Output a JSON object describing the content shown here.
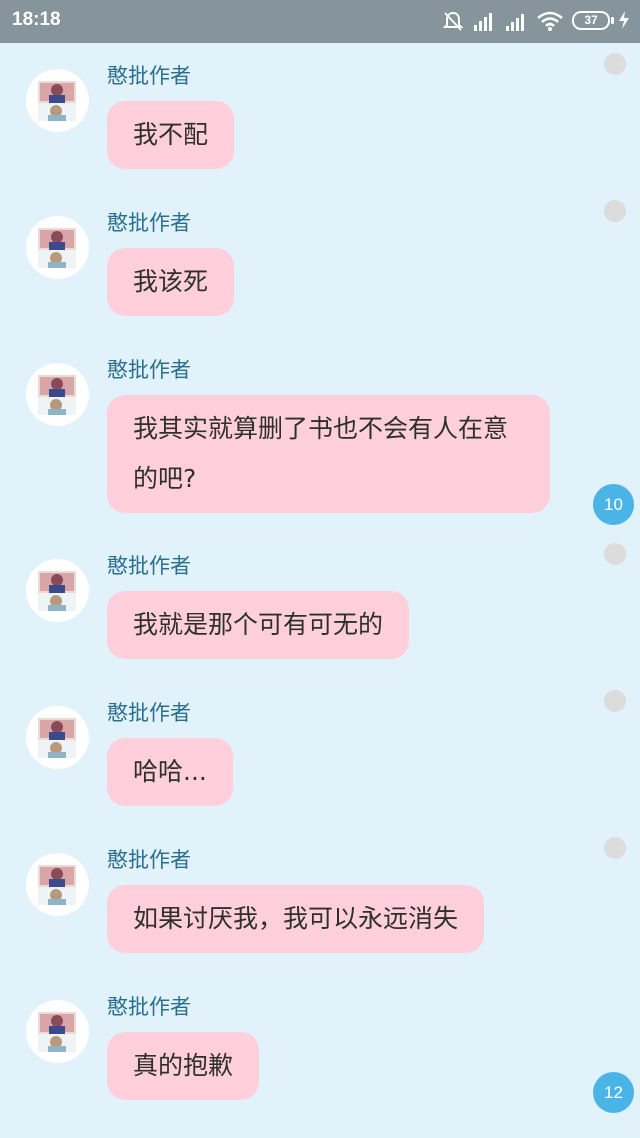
{
  "status_bar": {
    "time": "18:18",
    "battery": "37"
  },
  "messages": [
    {
      "sender": "憨批作者",
      "text": "我不配"
    },
    {
      "sender": "憨批作者",
      "text": "我该死"
    },
    {
      "sender": "憨批作者",
      "text": "我其实就算删了书也不会有人在意的吧?"
    },
    {
      "sender": "憨批作者",
      "text": "我就是那个可有可无的"
    },
    {
      "sender": "憨批作者",
      "text": "哈哈..."
    },
    {
      "sender": "憨批作者",
      "text": "如果讨厌我，我可以永远消失"
    },
    {
      "sender": "憨批作者",
      "text": "真的抱歉"
    }
  ],
  "badges": [
    {
      "count": "10"
    },
    {
      "count": "12"
    }
  ],
  "colors": {
    "background": "#e1f2fb",
    "bubble": "#ffd0db",
    "sender": "#2a6f8e",
    "badge": "#4ab4e6",
    "status_bar": "#86949b"
  }
}
